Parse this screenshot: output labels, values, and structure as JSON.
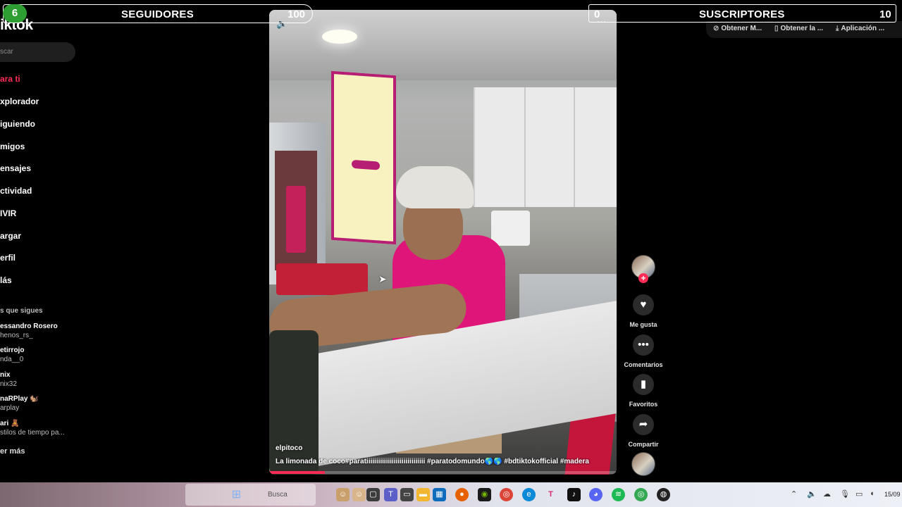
{
  "sidebar": {
    "logo": "iktok",
    "search_placeholder": "scar",
    "nav": [
      {
        "label": "ara ti",
        "active": true
      },
      {
        "label": "xplorador"
      },
      {
        "label": "iguiendo"
      },
      {
        "label": "migos"
      },
      {
        "label": "ensajes"
      },
      {
        "label": "ctividad"
      },
      {
        "label": "IVIR"
      },
      {
        "label": "argar"
      },
      {
        "label": "erfil"
      },
      {
        "label": "lás"
      }
    ],
    "following_title": "s que sigues",
    "accounts": [
      {
        "name": "essandro Rosero",
        "handle": "henos_rs_"
      },
      {
        "name": "etirrojo",
        "handle": "nda__0"
      },
      {
        "name": "nix",
        "handle": "nix32"
      },
      {
        "name": "naRPlay 🐿️",
        "handle": "arplay"
      },
      {
        "name": "ari 🧸",
        "handle": "stilos de tiempo pa..."
      }
    ],
    "see_more": "er más"
  },
  "overlay": {
    "left_badge": "6",
    "left_label": "SEGUIDORES",
    "left_value": "100",
    "right_value_left": "0",
    "right_label": "SUSCRIPTORES",
    "right_value": "10"
  },
  "toolbar": {
    "items": [
      {
        "icon": "link-icon",
        "label": "Obtener M..."
      },
      {
        "icon": "phone-icon",
        "label": "Obtener la ..."
      },
      {
        "icon": "download-icon",
        "label": "Aplicación ..."
      }
    ]
  },
  "video": {
    "username": "elpitoco",
    "caption": "La limonada de coco#paratiiiiiiiiiiiiiiiiiiiiiiiiiiiiii #paratodomundo🌎🌎 #bdtiktokofficial #madera",
    "progress": 0.16
  },
  "actions": {
    "like_label": "Me gusta",
    "comment_label": "Comentarios",
    "favorite_label": "Favoritos",
    "share_label": "Compartir"
  },
  "taskbar": {
    "search_text": "Busca",
    "clock": "15/09"
  },
  "colors": {
    "accent": "#fe2c55",
    "badge_green": "#2e9e33"
  }
}
